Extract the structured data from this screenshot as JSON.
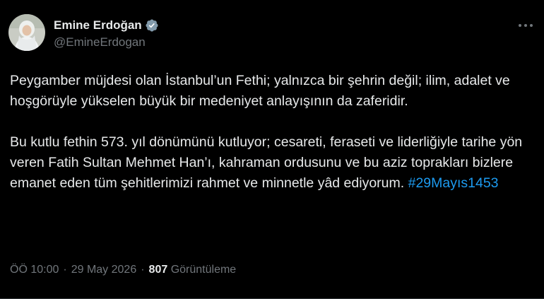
{
  "author": {
    "display_name": "Emine Erdoğan",
    "handle": "@EmineErdogan",
    "verified": true,
    "verified_badge_color": "#829aab"
  },
  "tweet": {
    "paragraph1": "Peygamber müjdesi olan İstanbul’un Fethi; yalnızca bir şehrin değil; ilim, adalet ve hoşgörüyle yükselen büyük bir medeniyet anlayışının da zaferidir.",
    "paragraph2_text": "Bu kutlu fethin 573. yıl dönümünü kutluyor; cesareti, feraseti ve liderliğiyle tarihe yön veren Fatih Sultan Mehmet Han’ı, kahraman ordusunu ve bu aziz toprakları bizlere emanet eden tüm şehitlerimizi rahmet ve minnetle yâd ediyorum.",
    "hashtag": "#29Mayıs1453"
  },
  "meta": {
    "time": "ÖÖ 10:00",
    "separator": "·",
    "date": "29 May 2026",
    "views_count": "807",
    "views_label": "Görüntüleme"
  },
  "icons": {
    "more": "more-options-icon",
    "verified": "verified-badge-icon"
  },
  "colors": {
    "background": "#000000",
    "text_primary": "#e7e9ea",
    "text_secondary": "#71767b",
    "link": "#1d9bf0"
  }
}
